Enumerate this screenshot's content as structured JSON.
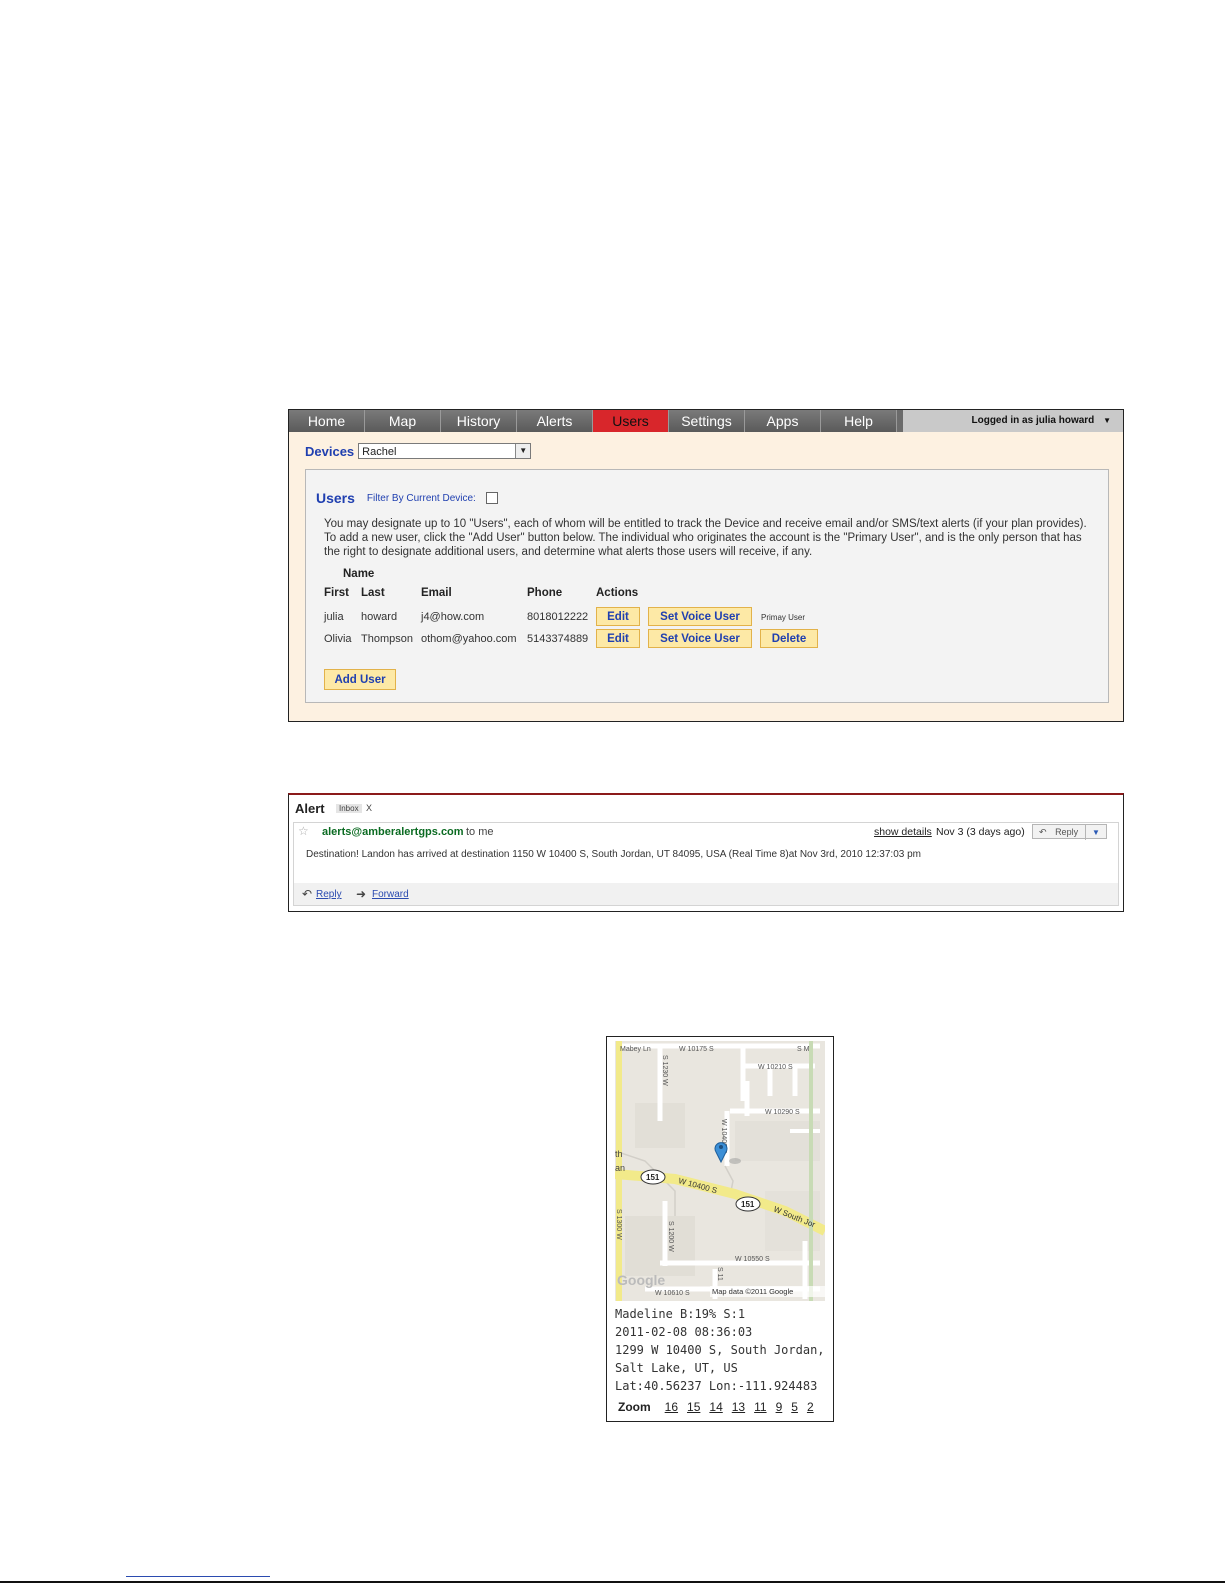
{
  "nav": {
    "tabs": [
      {
        "label": "Home",
        "active": false
      },
      {
        "label": "Map",
        "active": false
      },
      {
        "label": "History",
        "active": false
      },
      {
        "label": "Alerts",
        "active": false
      },
      {
        "label": "Users",
        "active": true
      },
      {
        "label": "Settings",
        "active": false
      },
      {
        "label": "Apps",
        "active": false
      },
      {
        "label": "Help",
        "active": false
      }
    ],
    "logged_in": "Logged in as julia howard"
  },
  "devices": {
    "label": "Devices",
    "selected": "Rachel"
  },
  "users": {
    "title": "Users",
    "filter_label": "Filter By Current Device:",
    "description": "You may designate up to 10 \"Users\", each of whom will be entitled to track the Device and receive email and/or SMS/text alerts (if your plan provides). To add a new user, click the \"Add User\" button below. The individual who originates the account is the \"Primary User\", and is the only person that has the right to designate additional users, and determine what alerts those users will receive, if any.",
    "headers": {
      "name": "Name",
      "first": "First",
      "last": "Last",
      "email": "Email",
      "phone": "Phone",
      "actions": "Actions"
    },
    "rows": [
      {
        "first": "julia",
        "last": "howard",
        "email": "j4@how.com",
        "phone": "8018012222",
        "edit": "Edit",
        "voice": "Set Voice User",
        "extra": "Primay User"
      },
      {
        "first": "Olivia",
        "last": "Thompson",
        "email": "othom@yahoo.com",
        "phone": "5143374889",
        "edit": "Edit",
        "voice": "Set Voice User",
        "extra": "Delete"
      }
    ],
    "add_user": "Add User"
  },
  "email": {
    "subject": "Alert",
    "label": "Inbox",
    "label_close": "X",
    "sender": "alerts@amberalertgps.com",
    "to": "to me",
    "show_details": "show details",
    "date": "Nov 3 (3 days ago)",
    "reply_button": "Reply",
    "body": "Destination! Landon has arrived at destination 1150 W 10400 S, South Jordan, UT 84095, USA (Real Time 8)at Nov 3rd, 2010 12:37:03 pm",
    "reply_link": "Reply",
    "forward_link": "Forward"
  },
  "map": {
    "labels": {
      "mabey": "Mabey Ln",
      "w10175": "W 10175 S",
      "sm": "S M",
      "s1230": "S 1230 W",
      "w10210": "W 10210 S",
      "w10290": "W 10290 S",
      "w10400s_v": "W 10400 S",
      "th": "th",
      "an": "an",
      "hw1": "151",
      "hw2": "151",
      "w10400s": "W 10400 S",
      "wsouthjor": "W South Jor",
      "s1300": "S 1300 W",
      "s1200": "S 1200 W",
      "w10550": "W 10550 S",
      "s11": "S 11",
      "w10610": "W 10610 S",
      "google": "Google",
      "mapdata": "Map data ©2011 Google"
    },
    "info": [
      "Madeline B:19% S:1",
      "2011-02-08 08:36:03",
      "1299 W 10400 S, South Jordan,",
      "Salt Lake, UT, US",
      "Lat:40.56237 Lon:-111.924483"
    ],
    "zoom_label": "Zoom",
    "zoom_levels": [
      "16",
      "15",
      "14",
      "13",
      "11",
      "9",
      "5",
      "2"
    ]
  }
}
